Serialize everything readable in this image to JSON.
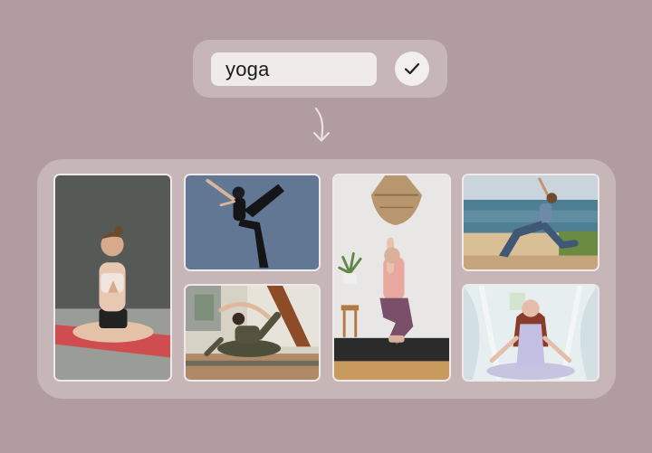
{
  "search": {
    "query": "yoga",
    "confirm_icon": "checkmark-icon"
  },
  "flow_icon": "arrow-down-icon",
  "gallery": {
    "items": [
      {
        "name": "woman-meditating-studio"
      },
      {
        "name": "woman-dancer-pose"
      },
      {
        "name": "woman-eagle-pose"
      },
      {
        "name": "woman-beach-lunge"
      },
      {
        "name": "woman-bow-pose-indoor"
      },
      {
        "name": "woman-meditating-white"
      }
    ]
  },
  "colors": {
    "background": "#b19ca0",
    "panel": "#c6b6b8",
    "input": "#efebeb",
    "button": "#f2efef"
  }
}
